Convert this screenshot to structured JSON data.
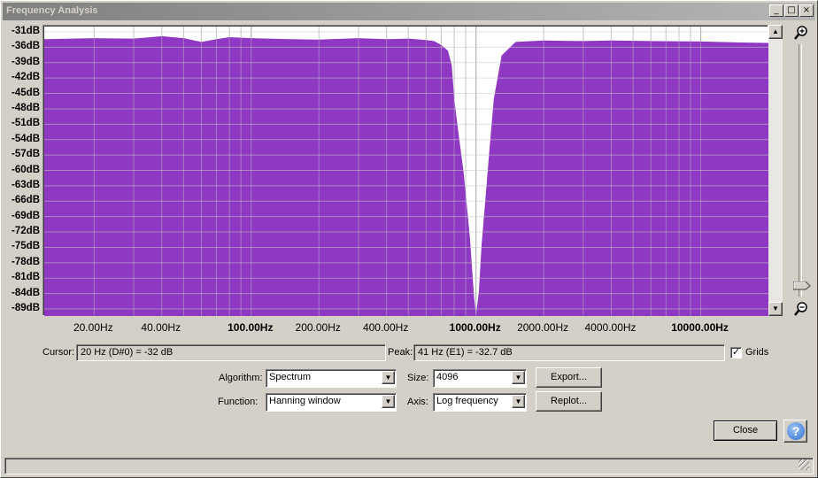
{
  "window": {
    "title": "Frequency Analysis",
    "minimize_glyph": "_",
    "maximize_glyph": "□",
    "close_glyph": "×"
  },
  "plot": {
    "fill_color": "#8e38c4",
    "background": "#ffffff",
    "grid_color": "#c8c8c8",
    "y_labels": [
      "-31dB",
      "-36dB",
      "-39dB",
      "-42dB",
      "-45dB",
      "-48dB",
      "-51dB",
      "-54dB",
      "-57dB",
      "-60dB",
      "-63dB",
      "-66dB",
      "-69dB",
      "-72dB",
      "-75dB",
      "-78dB",
      "-81dB",
      "-84dB",
      "-89dB"
    ],
    "x_labels": [
      {
        "text": "20.00Hz",
        "bold": false
      },
      {
        "text": "40.00Hz",
        "bold": false
      },
      {
        "text": "100.00Hz",
        "bold": true
      },
      {
        "text": "200.00Hz",
        "bold": false
      },
      {
        "text": "400.00Hz",
        "bold": false
      },
      {
        "text": "1000.00Hz",
        "bold": true
      },
      {
        "text": "2000.00Hz",
        "bold": false
      },
      {
        "text": "4000.00Hz",
        "bold": false
      },
      {
        "text": "10000.00Hz",
        "bold": true
      }
    ],
    "zoom_in_icon": "zoom-in",
    "zoom_out_icon": "zoom-out"
  },
  "chart_data": {
    "type": "area",
    "xscale": "log",
    "x_unit": "Hz",
    "y_unit": "dB",
    "xlim": [
      12,
      20000
    ],
    "ylim": [
      -90,
      -30
    ],
    "grid": true,
    "x": [
      12,
      20,
      30,
      40,
      50,
      60,
      70,
      80,
      100,
      150,
      200,
      300,
      400,
      500,
      600,
      650,
      700,
      750,
      780,
      800,
      840,
      880,
      910,
      940,
      960,
      980,
      1000,
      1030,
      1060,
      1100,
      1150,
      1200,
      1300,
      1500,
      2000,
      3000,
      4000,
      6000,
      10000,
      15000,
      20000
    ],
    "y": [
      -32.6,
      -32.4,
      -32.5,
      -32.0,
      -32.4,
      -33.2,
      -32.6,
      -32.2,
      -32.4,
      -32.6,
      -32.7,
      -32.4,
      -32.6,
      -32.5,
      -32.8,
      -33.0,
      -33.8,
      -35.0,
      -38.0,
      -45.0,
      -53.0,
      -60.0,
      -67.0,
      -74.0,
      -80.0,
      -86.0,
      -89.8,
      -85.0,
      -75.0,
      -66.0,
      -55.0,
      -45.0,
      -36.0,
      -33.2,
      -32.9,
      -33.0,
      -32.9,
      -33.0,
      -33.1,
      -33.3,
      -33.4
    ]
  },
  "readout": {
    "cursor_label": "Cursor:",
    "cursor_value": "20 Hz (D#0) = -32 dB",
    "peak_label": "Peak:",
    "peak_value": "41 Hz (E1) = -32.7 dB",
    "grids_label": "Grids",
    "grids_checked": "✓"
  },
  "controls": {
    "algorithm_label": "Algorithm:",
    "algorithm_value": "Spectrum",
    "function_label": "Function:",
    "function_value": "Hanning window",
    "size_label": "Size:",
    "size_value": "4096",
    "axis_label": "Axis:",
    "axis_value": "Log frequency",
    "export_label": "Export...",
    "replot_label": "Replot...",
    "close_label": "Close",
    "help_glyph": "?",
    "dropdown_glyph": "▼"
  }
}
